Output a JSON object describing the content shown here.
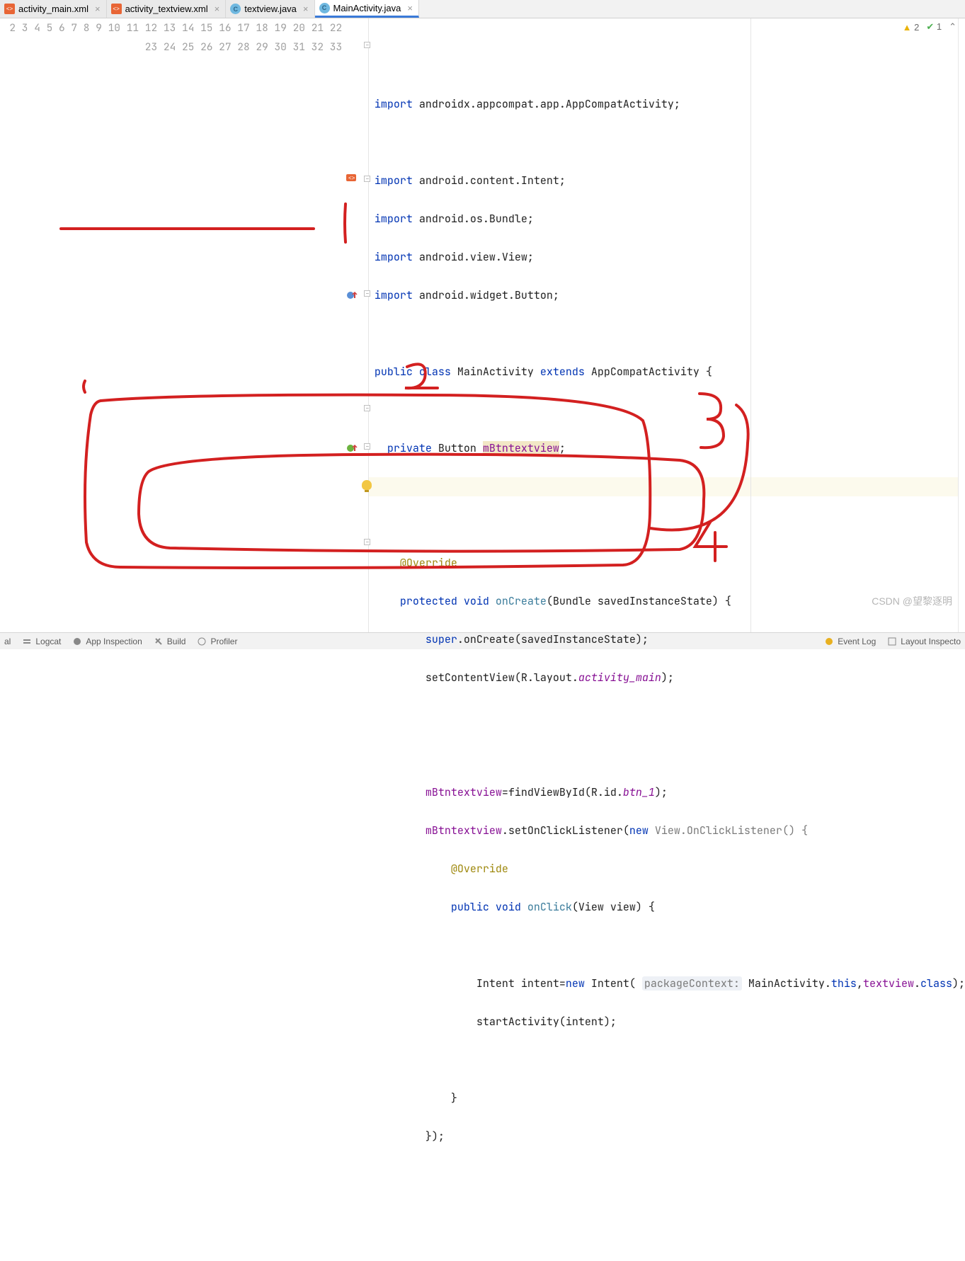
{
  "tabs": [
    {
      "label": "activity_main.xml",
      "icon": "xml",
      "active": false
    },
    {
      "label": "activity_textview.xml",
      "icon": "xml",
      "active": false
    },
    {
      "label": "textview.java",
      "icon": "java",
      "active": false
    },
    {
      "label": "MainActivity.java",
      "icon": "java",
      "active": true
    }
  ],
  "indicators": {
    "warnings": "2",
    "passes": "1"
  },
  "line_numbers_start": 2,
  "line_numbers_end": 33,
  "code": {
    "l2": "",
    "l3_kw": "import",
    "l3_rest": " androidx.appcompat.app.AppCompatActivity;",
    "l4": "",
    "l5_kw": "import",
    "l5_rest": " android.content.Intent;",
    "l6_kw": "import",
    "l6_rest": " android.os.Bundle;",
    "l7_kw": "import",
    "l7_rest": " android.view.View;",
    "l8_kw": "import",
    "l8_rest": " android.widget.Button;",
    "l9": "",
    "l10_public": "public ",
    "l10_class": "class ",
    "l10_name": "MainActivity ",
    "l10_extends": "extends ",
    "l10_super": "AppCompatActivity {",
    "l11": "",
    "l12_priv": "  private ",
    "l12_type": "Button ",
    "l12_field": "mBtntextview",
    "l12_semi": ";",
    "l13": "",
    "l14": "",
    "l15_annot": "    @Override",
    "l16_prot": "    protected ",
    "l16_void": "void ",
    "l16_method": "onCreate",
    "l16_params": "(Bundle savedInstanceState) {",
    "l17_super": "        super",
    "l17_rest": ".onCreate(savedInstanceState);",
    "l18_a": "        setContentView(R.layout.",
    "l18_b": "activity_main",
    "l18_c": ");",
    "l19": "",
    "l20": "",
    "l21_a": "        ",
    "l21_field": "mBtntextview",
    "l21_b": "=findViewById(R.id.",
    "l21_c": "btn_1",
    "l21_d": ");",
    "l22_a": "        ",
    "l22_field": "mBtntextview",
    "l22_b": ".setOnClickListener(",
    "l22_new": "new ",
    "l22_c": "View",
    "l22_d": ".",
    "l22_e": "OnClickListener",
    "l22_f": "() {",
    "l23_annot": "            @Override",
    "l24_pub": "            public ",
    "l24_void": "void ",
    "l24_m": "onClick",
    "l24_p": "(View view) {",
    "l25": "",
    "l26_a": "                Intent intent=",
    "l26_new": "new ",
    "l26_b": "Intent( ",
    "l26_hint": "packageContext:",
    "l26_c": " MainActivity.",
    "l26_this": "this",
    "l26_d": ",",
    "l26_e": "textview",
    "l26_f": ".",
    "l26_class": "class",
    "l26_g": ");",
    "l27": "                startActivity(intent);",
    "l28": "",
    "l29": "            }",
    "l30": "        });",
    "l31": "",
    "l32": ""
  },
  "bottom_bar": {
    "left": [
      "al",
      "Logcat",
      "App Inspection",
      "Build",
      "Profiler"
    ],
    "right": [
      "Event Log",
      "Layout Inspecto"
    ]
  },
  "watermark": "CSDN @望黎逐明"
}
